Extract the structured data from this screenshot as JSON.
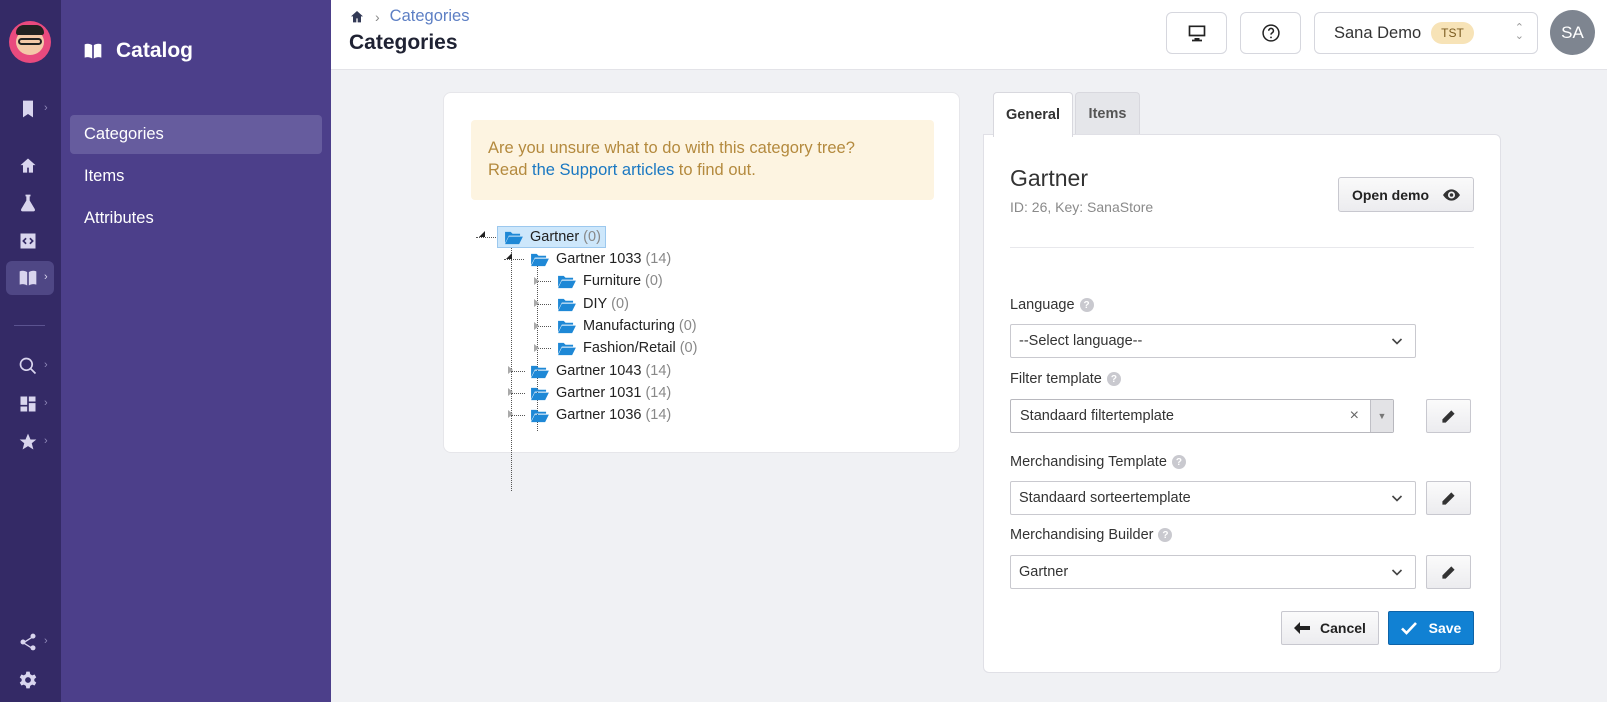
{
  "rail": {
    "icons": [
      "bookmark-icon",
      "home-icon",
      "flask-icon",
      "code-icon",
      "book-icon",
      "search-icon",
      "dashboard-icon",
      "star-icon",
      "share-icon",
      "gear-icon"
    ]
  },
  "sidebar": {
    "title": "Catalog",
    "items": [
      {
        "label": "Categories",
        "active": true
      },
      {
        "label": "Items",
        "active": false
      },
      {
        "label": "Attributes",
        "active": false
      }
    ]
  },
  "header": {
    "breadcrumb": "Categories",
    "page_title": "Categories",
    "store_name": "Sana Demo",
    "store_badge": "TST",
    "avatar_initials": "SA"
  },
  "notice": {
    "line1": "Are you unsure what to do with this category tree?",
    "prefix": "Read ",
    "link": "the Support articles",
    "suffix": " to find out."
  },
  "tree": [
    {
      "label": "Gartner",
      "count": "(0)",
      "level": 0,
      "selected": true
    },
    {
      "label": "Gartner 1033",
      "count": "(14)",
      "level": 1
    },
    {
      "label": "Furniture",
      "count": "(0)",
      "level": 2
    },
    {
      "label": "DIY",
      "count": "(0)",
      "level": 2
    },
    {
      "label": "Manufacturing",
      "count": "(0)",
      "level": 2
    },
    {
      "label": "Fashion/Retail",
      "count": "(0)",
      "level": 2
    },
    {
      "label": "Gartner 1043",
      "count": "(14)",
      "level": 1
    },
    {
      "label": "Gartner 1031",
      "count": "(14)",
      "level": 1
    },
    {
      "label": "Gartner 1036",
      "count": "(14)",
      "level": 1
    }
  ],
  "tabs": [
    {
      "label": "General",
      "active": true
    },
    {
      "label": "Items",
      "active": false
    }
  ],
  "detail": {
    "title": "Gartner",
    "meta": "ID: 26, Key: SanaStore",
    "open_demo_label": "Open demo",
    "language_label": "Language",
    "language_value": "--Select language--",
    "filter_label": "Filter template",
    "filter_value": "Standaard filtertemplate",
    "merch_template_label": "Merchandising Template",
    "merch_template_value": "Standaard sorteertemplate",
    "merch_builder_label": "Merchandising Builder",
    "merch_builder_value": "Gartner",
    "help_glyph": "?",
    "cancel_label": "Cancel",
    "save_label": "Save"
  },
  "colors": {
    "rail_bg": "#342a66",
    "sidebar_bg": "#4c3f8a",
    "accent_blue": "#1181d3",
    "notice_bg": "#fdf4e1",
    "folder_blue": "#1e88d6"
  }
}
